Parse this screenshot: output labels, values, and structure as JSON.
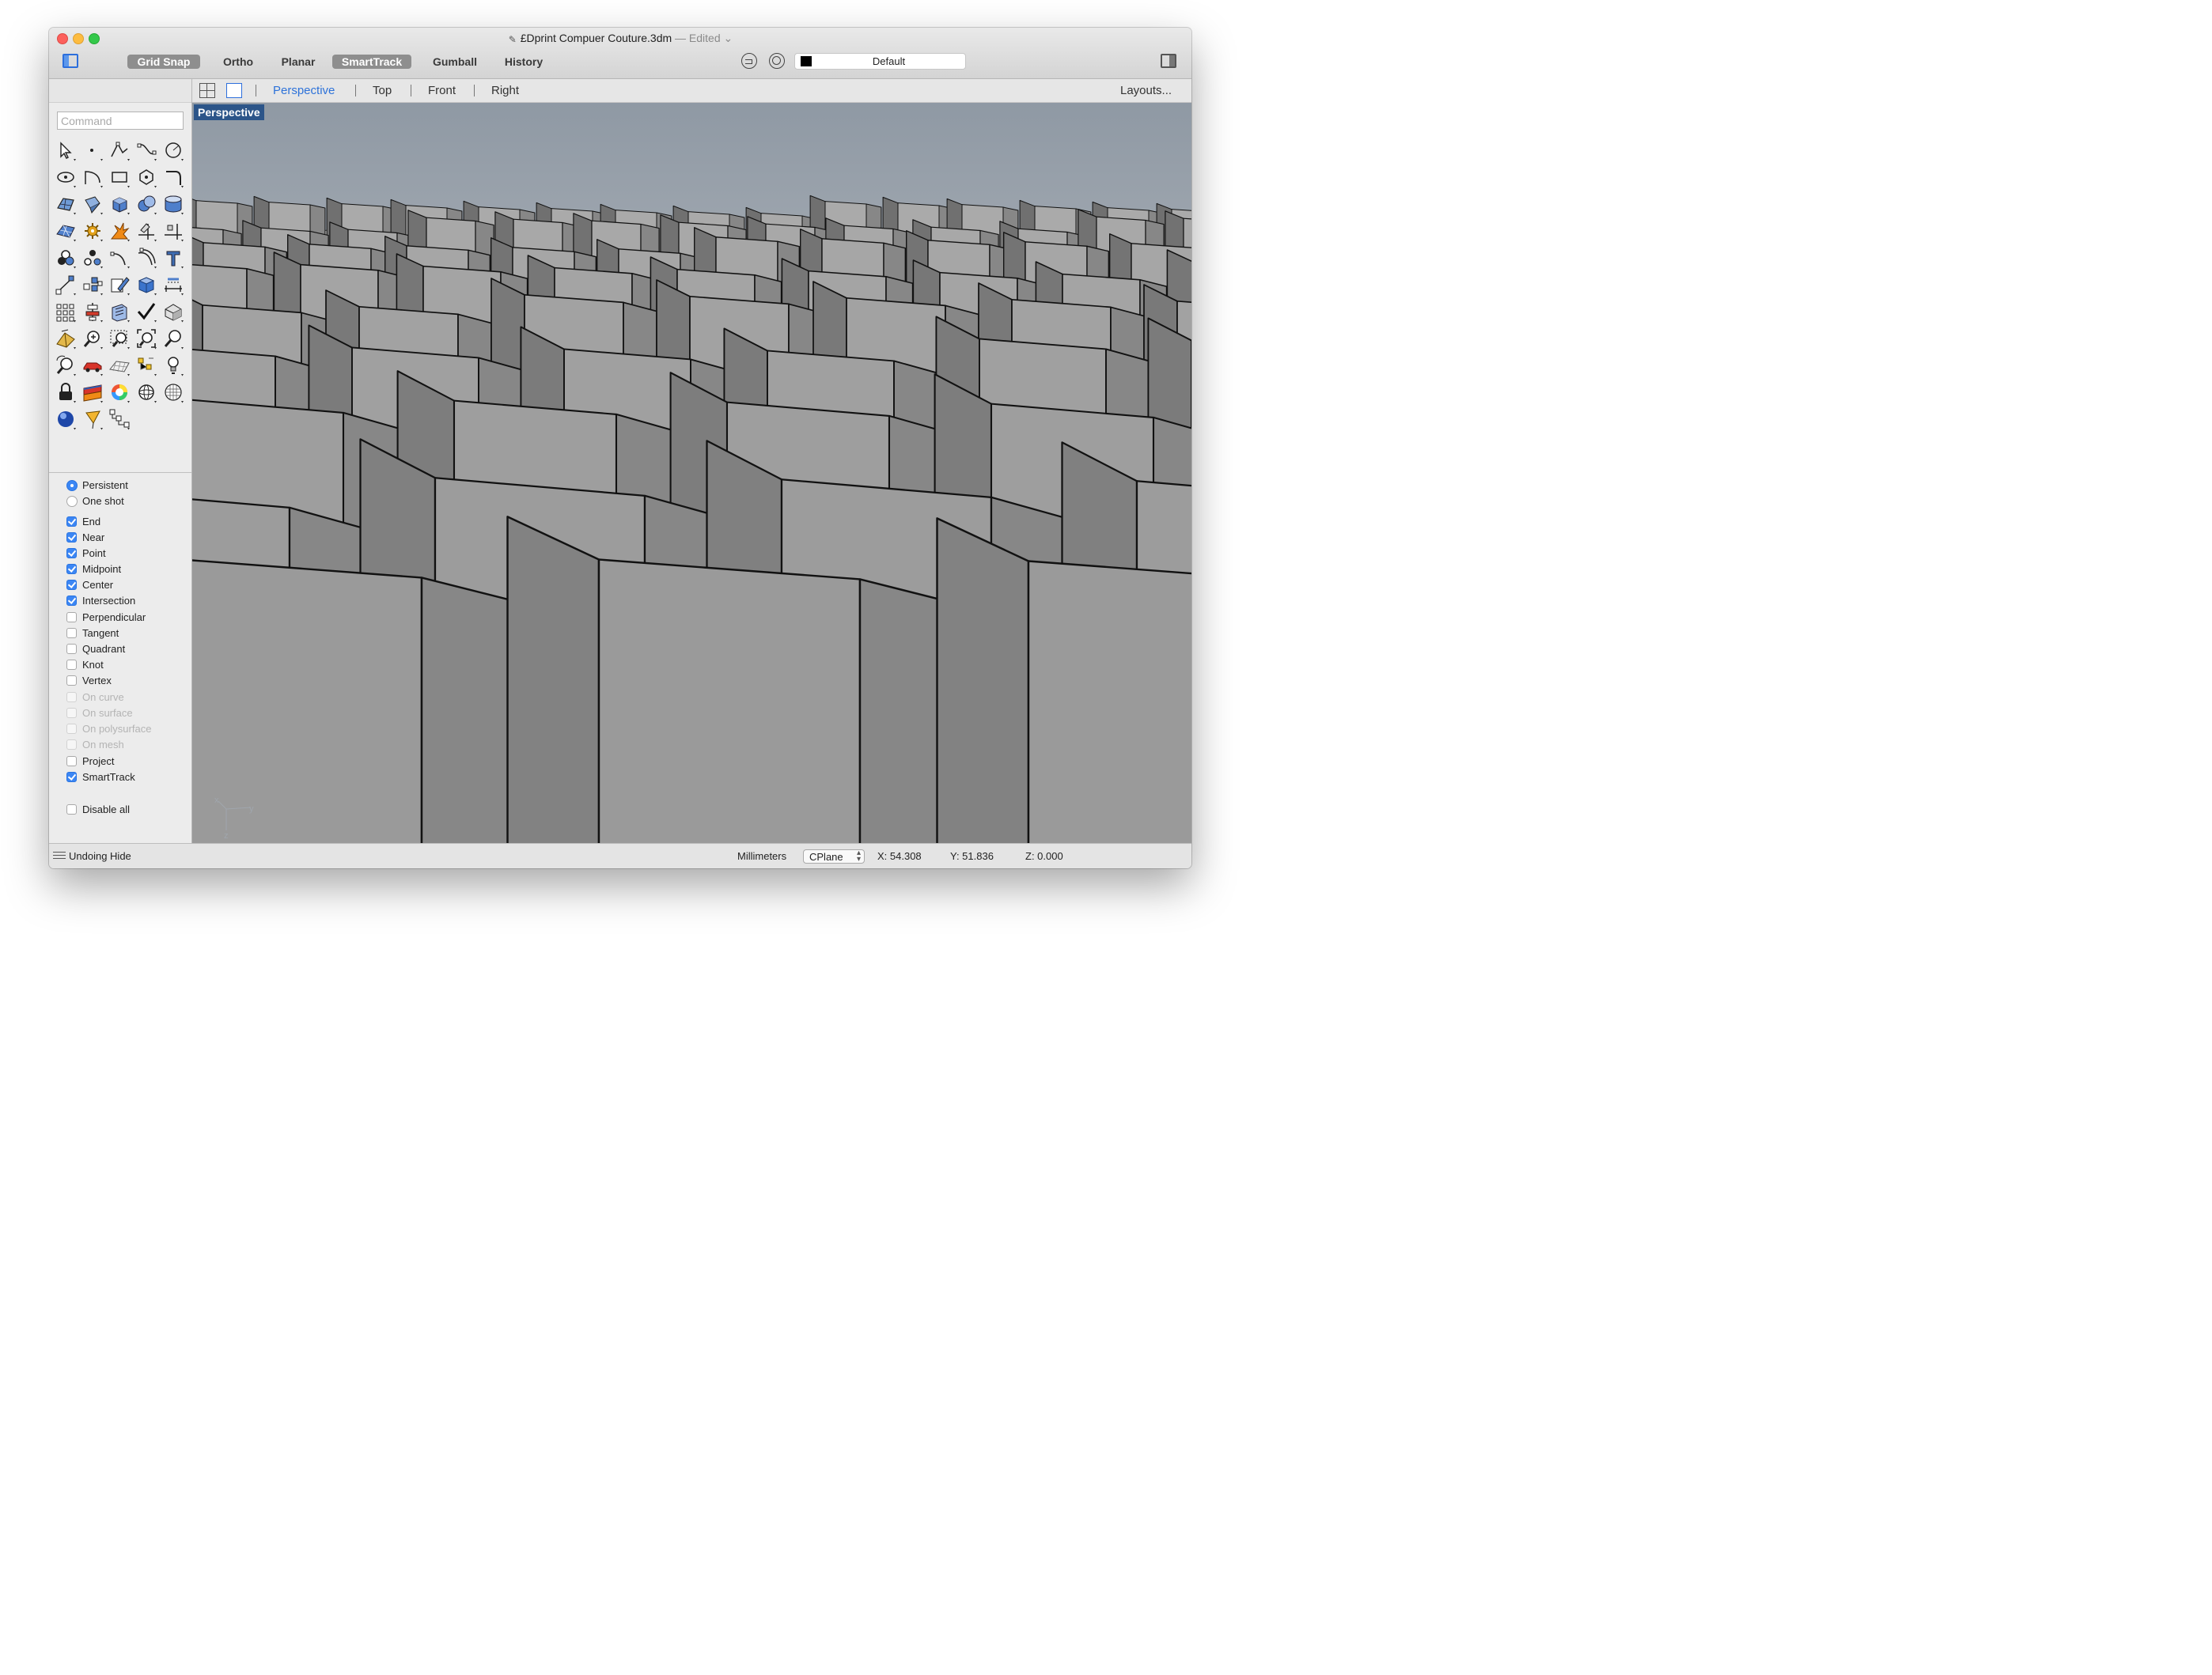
{
  "window": {
    "title": "£Dprint Compuer Couture.3dm",
    "edited": "— Edited",
    "edited_chevron": "⌄",
    "doc_icon": "rhino-document-icon"
  },
  "toolbar": {
    "modes": [
      {
        "label": "Grid Snap",
        "on": true
      },
      {
        "label": "Ortho",
        "on": false
      },
      {
        "label": "Planar",
        "on": false
      },
      {
        "label": "SmartTrack",
        "on": true
      },
      {
        "label": "Gumball",
        "on": false
      },
      {
        "label": "History",
        "on": false
      }
    ],
    "layer": {
      "name": "Default",
      "color": "#000000"
    }
  },
  "command": {
    "placeholder": "Command",
    "value": ""
  },
  "viewport_tabs": {
    "tabs": [
      "Perspective",
      "Top",
      "Front",
      "Right"
    ],
    "active": "Perspective",
    "layouts_label": "Layouts..."
  },
  "viewport": {
    "label": "Perspective",
    "axis": {
      "x": "x",
      "y": "y",
      "z": "z"
    }
  },
  "osnap": {
    "mode": [
      {
        "label": "Persistent",
        "selected": true
      },
      {
        "label": "One shot",
        "selected": false
      }
    ],
    "items": [
      {
        "label": "End",
        "checked": true,
        "enabled": true
      },
      {
        "label": "Near",
        "checked": true,
        "enabled": true
      },
      {
        "label": "Point",
        "checked": true,
        "enabled": true
      },
      {
        "label": "Midpoint",
        "checked": true,
        "enabled": true
      },
      {
        "label": "Center",
        "checked": true,
        "enabled": true
      },
      {
        "label": "Intersection",
        "checked": true,
        "enabled": true
      },
      {
        "label": "Perpendicular",
        "checked": false,
        "enabled": true
      },
      {
        "label": "Tangent",
        "checked": false,
        "enabled": true
      },
      {
        "label": "Quadrant",
        "checked": false,
        "enabled": true
      },
      {
        "label": "Knot",
        "checked": false,
        "enabled": true
      },
      {
        "label": "Vertex",
        "checked": false,
        "enabled": true
      },
      {
        "label": "On curve",
        "checked": false,
        "enabled": false
      },
      {
        "label": "On surface",
        "checked": false,
        "enabled": false
      },
      {
        "label": "On polysurface",
        "checked": false,
        "enabled": false
      },
      {
        "label": "On mesh",
        "checked": false,
        "enabled": false
      },
      {
        "label": "Project",
        "checked": false,
        "enabled": true
      },
      {
        "label": "SmartTrack",
        "checked": true,
        "enabled": true
      }
    ],
    "disable_all": {
      "label": "Disable all",
      "checked": false
    }
  },
  "tools": [
    [
      "select-arrow-icon",
      "point-icon",
      "polyline-icon",
      "curve-icon",
      "circle-icon"
    ],
    [
      "ellipse-icon",
      "arc-icon",
      "rectangle-icon",
      "polygon-icon",
      "fillet-curve-icon"
    ],
    [
      "surface-icon",
      "sweep-surface-icon",
      "box-solid-icon",
      "boolean-union-icon",
      "cylinder-icon"
    ],
    [
      "mesh-icon",
      "gear-icon",
      "explode-icon",
      "trim-icon",
      "split-icon"
    ],
    [
      "group-icon",
      "ungroup-icon",
      "join-icon",
      "offset-icon",
      "text-icon"
    ],
    [
      "move-icon",
      "array-icon",
      "edit-icon",
      "block-icon",
      "dimension-icon"
    ],
    [
      "array-grid-icon",
      "align-icon",
      "layout-icon",
      "check-icon",
      "analyze-icon"
    ],
    [
      "render-icon",
      "zoom-in-icon",
      "zoom-window-icon",
      "zoom-extents-icon",
      "zoom-icon"
    ],
    [
      "rotate-view-icon",
      "car-icon",
      "grid-plane-icon",
      "lights-icon",
      "bulb-icon"
    ],
    [
      "lock-icon",
      "materials-icon",
      "color-wheel-icon",
      "sphere-wire-icon",
      "grid-sphere-icon"
    ],
    [
      "render-sphere-icon",
      "cone-icon",
      "pipeline-icon"
    ]
  ],
  "statusbar": {
    "message": "Undoing Hide",
    "units": "Millimeters",
    "cplane": "CPlane",
    "x": "X: 54.308",
    "y": "Y: 51.836",
    "z": "Z: 0.000"
  }
}
